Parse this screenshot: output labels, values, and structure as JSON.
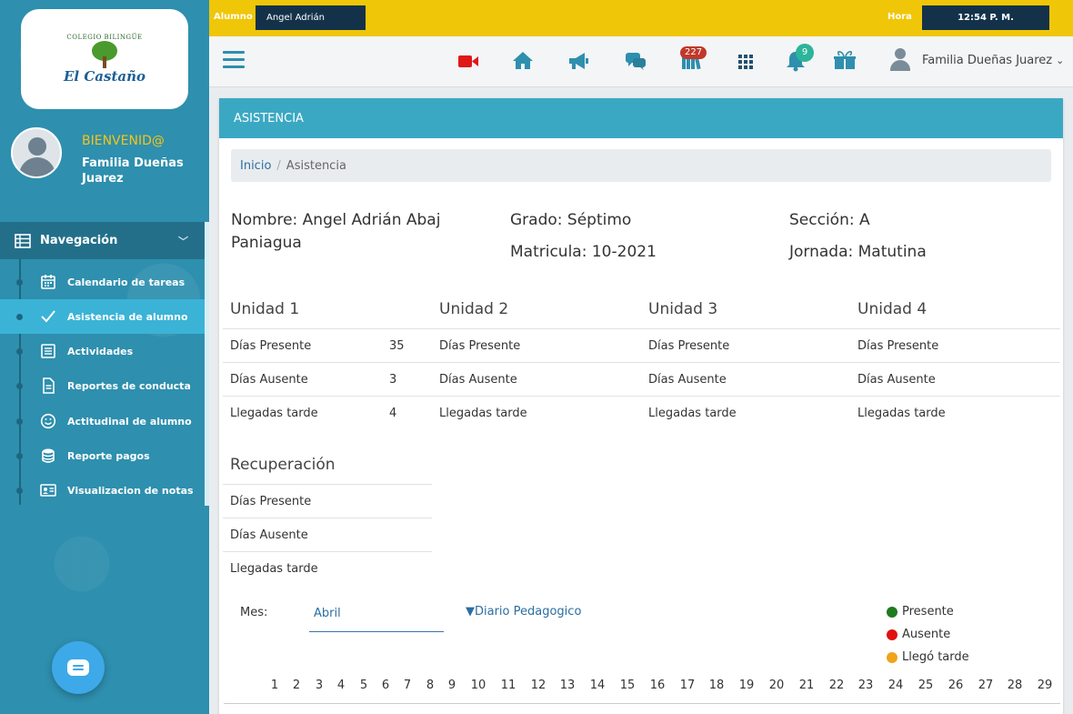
{
  "topbar": {
    "alumno_label": "Alumno",
    "alumno_value": "Angel Adrián",
    "hora_label": "Hora",
    "hora_value": "12:54 P. M."
  },
  "header": {
    "badge_messages": "227",
    "badge_notifications": "9",
    "profile_name": "Familia Dueñas Juarez",
    "profile_chevron": "⌄",
    "icons": [
      "video-icon",
      "home-icon",
      "megaphone-icon",
      "chat-icon",
      "library-icon",
      "apps-grid-icon",
      "bell-icon",
      "gift-icon"
    ]
  },
  "sidebar": {
    "logo_top": "COLEGIO BILINGÜE",
    "logo_name": "El Castaño",
    "welcome": "BIENVENID@",
    "user_name": "Familia Dueñas Juarez",
    "nav_header": "Navegación",
    "items": [
      {
        "label": "Calendario de tareas",
        "icon": "calendar-icon"
      },
      {
        "label": "Asistencia de alumno",
        "icon": "check-icon"
      },
      {
        "label": "Actividades",
        "icon": "list-icon"
      },
      {
        "label": "Reportes de conducta",
        "icon": "document-icon"
      },
      {
        "label": "Actitudinal de alumno",
        "icon": "smile-icon"
      },
      {
        "label": "Reporte pagos",
        "icon": "database-icon"
      },
      {
        "label": "Visualizacion de notas",
        "icon": "id-card-icon"
      }
    ]
  },
  "card": {
    "title": "ASISTENCIA",
    "breadcrumb": {
      "home": "Inicio",
      "separator": "/",
      "current": "Asistencia"
    },
    "student": {
      "nombre": "Nombre: Angel Adrián Abaj Paniagua",
      "grado": "Grado: Séptimo",
      "matricula": "Matricula: 10-2021",
      "seccion": "Sección: A",
      "jornada": "Jornada: Matutina"
    },
    "units": [
      {
        "title": "Unidad 1",
        "rows": [
          {
            "label": "Días Presente",
            "value": "35"
          },
          {
            "label": "Días Ausente",
            "value": "3"
          },
          {
            "label": "Llegadas tarde",
            "value": "4"
          }
        ]
      },
      {
        "title": "Unidad 2",
        "rows": [
          {
            "label": "Días Presente",
            "value": ""
          },
          {
            "label": "Días Ausente",
            "value": ""
          },
          {
            "label": "Llegadas tarde",
            "value": ""
          }
        ]
      },
      {
        "title": "Unidad 3",
        "rows": [
          {
            "label": "Días Presente",
            "value": ""
          },
          {
            "label": "Días Ausente",
            "value": ""
          },
          {
            "label": "Llegadas tarde",
            "value": ""
          }
        ]
      },
      {
        "title": "Unidad 4",
        "rows": [
          {
            "label": "Días Presente",
            "value": ""
          },
          {
            "label": "Días Ausente",
            "value": ""
          },
          {
            "label": "Llegadas tarde",
            "value": ""
          }
        ]
      }
    ],
    "recuperacion": {
      "title": "Recuperación",
      "rows": [
        {
          "label": "Días Presente"
        },
        {
          "label": "Días Ausente"
        },
        {
          "label": "Llegadas tarde"
        }
      ]
    },
    "month": {
      "label": "Mes:",
      "selected": "Abril"
    },
    "diario": "▼Diario Pedagogico",
    "legend": [
      {
        "label": "Presente",
        "color": "#1e7b1e"
      },
      {
        "label": "Ausente",
        "color": "#e01010"
      },
      {
        "label": "Llegó tarde",
        "color": "#f0a41a"
      }
    ],
    "days": [
      "1",
      "2",
      "3",
      "4",
      "5",
      "6",
      "7",
      "8",
      "9",
      "10",
      "11",
      "12",
      "13",
      "14",
      "15",
      "16",
      "17",
      "18",
      "19",
      "20",
      "21",
      "22",
      "23",
      "24",
      "25",
      "26",
      "27",
      "28",
      "29"
    ]
  }
}
